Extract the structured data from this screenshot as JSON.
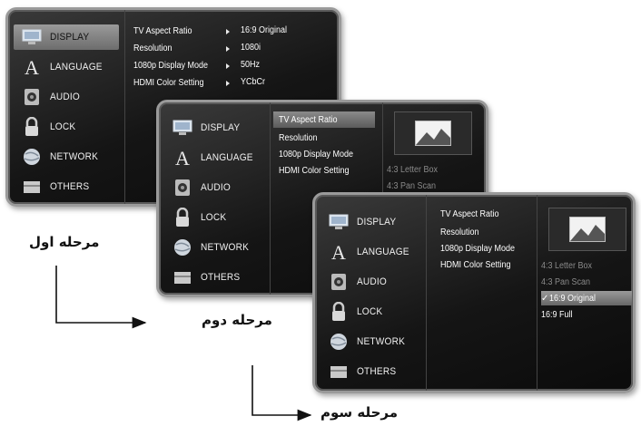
{
  "menu": {
    "items": [
      {
        "label": "DISPLAY",
        "icon": "monitor-icon"
      },
      {
        "label": "LANGUAGE",
        "icon": "letter-a-icon"
      },
      {
        "label": "AUDIO",
        "icon": "speaker-icon"
      },
      {
        "label": "LOCK",
        "icon": "padlock-icon"
      },
      {
        "label": "NETWORK",
        "icon": "globe-icon"
      },
      {
        "label": "OTHERS",
        "icon": "folder-icon"
      }
    ],
    "settings": [
      {
        "label": "TV Aspect Ratio",
        "value": "16:9 Original"
      },
      {
        "label": "Resolution",
        "value": "1080i"
      },
      {
        "label": "1080p Display Mode",
        "value": "50Hz"
      },
      {
        "label": "HDMI Color Setting",
        "value": "YCbCr"
      }
    ],
    "aspect_options": [
      "4:3 Letter Box",
      "4:3 Pan Scan",
      "16:9 Original",
      "16:9 Full"
    ],
    "check_mark": "✓"
  },
  "steps": {
    "step1": "مرحله اول",
    "step2": "مرحله دوم",
    "step3": "مرحله سوم"
  },
  "colors": {
    "highlight": "#8a8a8a",
    "frame": "#9a9a9a",
    "menu_bg": "#151515"
  }
}
